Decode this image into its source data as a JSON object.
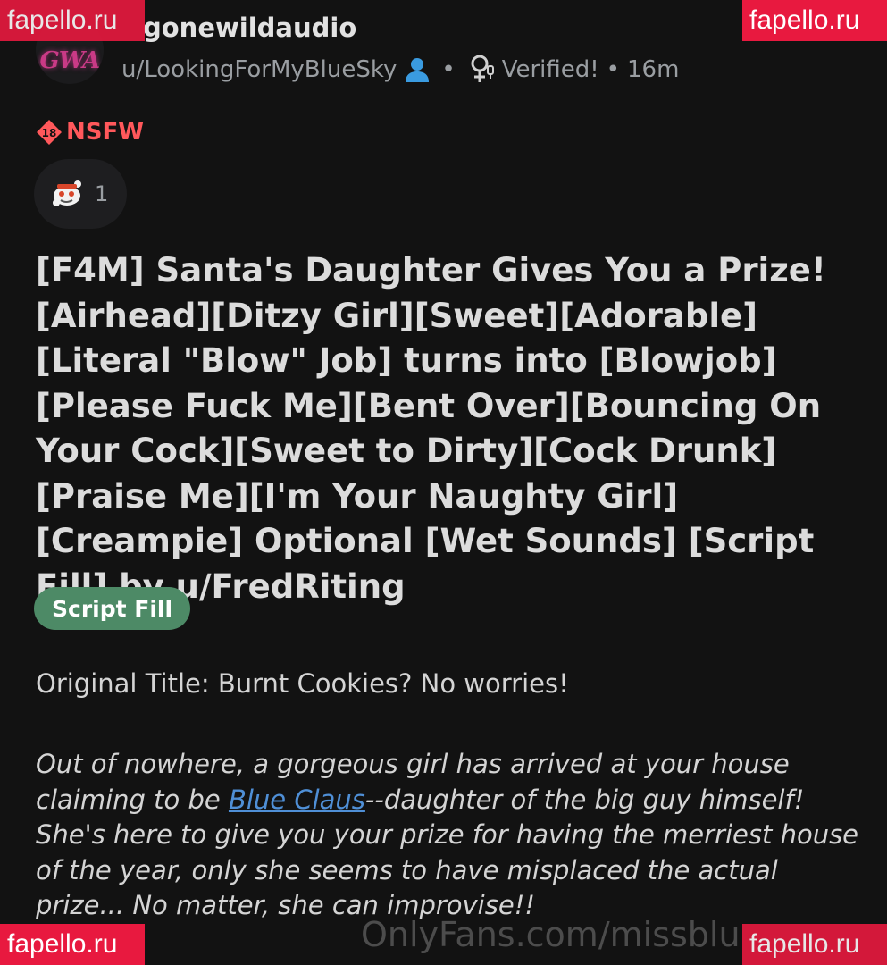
{
  "header": {
    "avatar_text": "GWA",
    "subreddit": "gonewildaudio",
    "username": "u/LookingForMyBlueSky",
    "separator": "•",
    "user_flair": "Verified!",
    "separator2": "•",
    "time_ago": "16m"
  },
  "post": {
    "nsfw_badge": "18",
    "nsfw_label": "NSFW",
    "award_count": "1",
    "title": "[F4M] Santa's Daughter Gives You a Prize! [Airhead][Ditzy Girl][Sweet][Adorable][Literal \"Blow\" Job] turns into [Blowjob][Please Fuck Me][Bent Over][Bouncing On Your Cock][Sweet to Dirty][Cock Drunk][Praise Me][I'm Your Naughty Girl][Creampie] Optional [Wet Sounds] [Script Fill] by u/FredRiting",
    "flair": "Script Fill",
    "original_title": "Original Title: Burnt Cookies? No worries!",
    "body_part1": "Out of nowhere, a gorgeous girl has arrived at your house claiming to be ",
    "body_link": "Blue Claus",
    "body_part2": "--daughter of the big guy himself! She's here to give you your prize for having the merriest house of the year, only she seems to have misplaced the actual prize... No matter, she can improvise!!"
  },
  "watermarks": {
    "top_left": "fapello.ru",
    "top_right": "fapello.ru",
    "bottom_left": "fapello.ru",
    "bottom_right": "fapello.ru",
    "onlyfans": "OnlyFans.com/missblu"
  },
  "colors": {
    "background": "#121212",
    "nsfw": "#ff585b",
    "flair_bg": "#4d8a66",
    "link": "#4f8fd6",
    "user_icon": "#3a9be0",
    "watermark_bg": "#e8193f"
  },
  "icons": {
    "user": "person-icon",
    "flair": "female-verified-icon",
    "award": "snoo-award-icon",
    "nsfw": "nsfw-18-icon"
  }
}
